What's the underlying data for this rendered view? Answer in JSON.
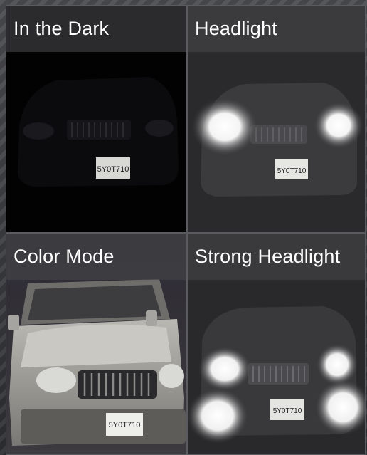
{
  "panels": [
    {
      "label": "In the Dark",
      "plate": "5Y0T710"
    },
    {
      "label": "Headlight",
      "plate": "5Y0T710"
    },
    {
      "label": "Color Mode",
      "plate": "5Y0T710"
    },
    {
      "label": "Strong Headlight",
      "plate": "5Y0T710"
    }
  ]
}
